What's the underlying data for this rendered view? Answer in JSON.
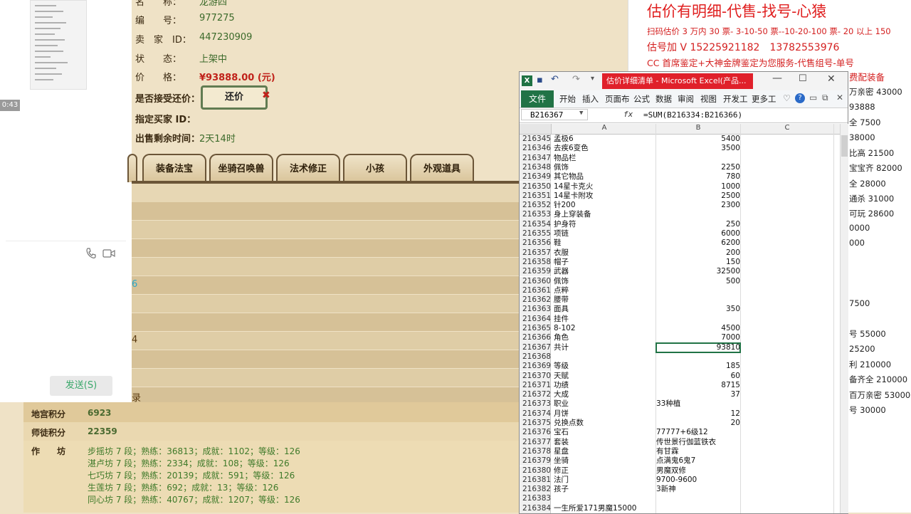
{
  "chat": {
    "time_badge": "0:43",
    "send_button": "发送(S)"
  },
  "listing": {
    "name_label": "名　　称：",
    "name_value": "龙游四",
    "id_label": "编　　号：",
    "id_value": "977275",
    "seller_label": "卖　家　ID：",
    "seller_value": "447230909",
    "status_label": "状　　态：",
    "status_value": "上架中",
    "price_label": "价　　格：",
    "price_value": "¥93888.00 (元)",
    "offer_label": "是否接受还价：",
    "offer_button": "还价",
    "buyer_label": "指定买家 ID：",
    "remain_label": "出售剩余时间：",
    "remain_value": "2天14时",
    "tabs": [
      "装备法宝",
      "坐骑召唤兽",
      "法术修正",
      "小孩",
      "外观道具"
    ],
    "partial_values": [
      "6",
      "4",
      "录"
    ]
  },
  "stats": {
    "items": [
      {
        "label": "地宫积分",
        "value": "6923"
      },
      {
        "label": "师徒积分",
        "value": "22359"
      }
    ],
    "workshop_label": "作　　坊",
    "workshops": [
      "步摇坊 7 段；熟练：36813；成就：1102；等级：126",
      "湛卢坊 7 段；熟练：2334；成就：108；等级：126",
      "七巧坊 7 段；熟练：20139；成就：591；等级：126",
      "生莲坊 7 段；熟练：692；成就：13；等级：126",
      "同心坊 7 段；熟练：40767；成就：1207；等级：126"
    ]
  },
  "doc": {
    "title": "估价有明细-代售-找号-心猿",
    "lines": [
      "扫码估价 3 万内 30 票- 3-10-50 票--10-20-100 票- 20 以上 150",
      "估号加 V 15225921182　13782553976",
      "CC 首席鉴定+大神金牌鉴定为您服务-代售组号-单号",
      "费配装备"
    ],
    "right_values": [
      "万亲密 43000",
      "93888",
      "全 7500",
      "38000",
      "比高 21500",
      "宝宝齐 82000",
      "全 28000",
      "通杀 31000",
      "可玩 28600",
      "0000",
      "000",
      "7500",
      "号 55000",
      "25200",
      "利 210000",
      "备齐全 210000",
      "百万亲密 53000",
      "号 30000"
    ]
  },
  "excel": {
    "window_title": "估价详细清单 - Microsoft Excel(产品...",
    "ribbon_file": "文件",
    "ribbon_tabs": [
      "开始",
      "插入",
      "页面布",
      "公式",
      "数据",
      "审阅",
      "视图",
      "开发工",
      "更多工"
    ],
    "name_box": "B216367",
    "fx": "fx",
    "formula": "=SUM(B216334:B216366)",
    "col_headers": [
      "A",
      "B",
      "C"
    ],
    "rows": [
      {
        "n": "216345",
        "a": "孟极6",
        "b": "5400",
        "num": true
      },
      {
        "n": "216346",
        "a": "去疾6变色",
        "b": "3500",
        "num": true
      },
      {
        "n": "216347",
        "a": "物品栏",
        "b": "",
        "num": true
      },
      {
        "n": "216348",
        "a": "佩饰",
        "b": "2250",
        "num": true
      },
      {
        "n": "216349",
        "a": "其它物品",
        "b": "780",
        "num": true
      },
      {
        "n": "216350",
        "a": "14星卡克火",
        "b": "1000",
        "num": true
      },
      {
        "n": "216351",
        "a": "14星卡附攻",
        "b": "2500",
        "num": true
      },
      {
        "n": "216352",
        "a": "针200",
        "b": "2300",
        "num": true
      },
      {
        "n": "216353",
        "a": "身上穿装备",
        "b": "",
        "num": true
      },
      {
        "n": "216354",
        "a": "护身符",
        "b": "250",
        "num": true
      },
      {
        "n": "216355",
        "a": "项链",
        "b": "6000",
        "num": true
      },
      {
        "n": "216356",
        "a": "鞋",
        "b": "6200",
        "num": true
      },
      {
        "n": "216357",
        "a": "衣服",
        "b": "200",
        "num": true
      },
      {
        "n": "216358",
        "a": "帽子",
        "b": "150",
        "num": true
      },
      {
        "n": "216359",
        "a": "武器",
        "b": "32500",
        "num": true
      },
      {
        "n": "216360",
        "a": "佩饰",
        "b": "500",
        "num": true
      },
      {
        "n": "216361",
        "a": "点粹",
        "b": "",
        "num": true
      },
      {
        "n": "216362",
        "a": "腰带",
        "b": "",
        "num": true
      },
      {
        "n": "216363",
        "a": "面具",
        "b": "350",
        "num": true
      },
      {
        "n": "216364",
        "a": "挂件",
        "b": "",
        "num": true
      },
      {
        "n": "216365",
        "a": "8-102",
        "b": "4500",
        "num": true
      },
      {
        "n": "216366",
        "a": "角色",
        "b": "7000",
        "num": true
      },
      {
        "n": "216367",
        "a": "共计",
        "b": "93810",
        "num": true
      },
      {
        "n": "216368",
        "a": "",
        "b": "",
        "num": true
      },
      {
        "n": "216369",
        "a": "等级",
        "b": "185",
        "num": true
      },
      {
        "n": "216370",
        "a": "天赋",
        "b": "60",
        "num": true
      },
      {
        "n": "216371",
        "a": "功绩",
        "b": "8715",
        "num": true
      },
      {
        "n": "216372",
        "a": "大成",
        "b": "37",
        "num": true
      },
      {
        "n": "216373",
        "a": "职业",
        "b": "33种植",
        "num": false
      },
      {
        "n": "216374",
        "a": "月饼",
        "b": "12",
        "num": true
      },
      {
        "n": "216375",
        "a": "兑换点数",
        "b": "20",
        "num": true
      },
      {
        "n": "216376",
        "a": "宝石",
        "b": "77777+6级12",
        "num": false
      },
      {
        "n": "216377",
        "a": "套装",
        "b": "传世景行伽蓝铁衣",
        "num": false
      },
      {
        "n": "216378",
        "a": "星盘",
        "b": "有甘霖",
        "num": false
      },
      {
        "n": "216379",
        "a": "坐骑",
        "b": "点满鬼6鬼7",
        "num": false
      },
      {
        "n": "216380",
        "a": "修正",
        "b": "男魔双修",
        "num": false
      },
      {
        "n": "216381",
        "a": "法门",
        "b": "9700-9600",
        "num": false
      },
      {
        "n": "216382",
        "a": "孩子",
        "b": "3新神",
        "num": false
      },
      {
        "n": "216383",
        "a": "",
        "b": "",
        "num": true
      },
      {
        "n": "216384",
        "a": "一生所爱171男魔15000",
        "b": "",
        "num": true
      }
    ]
  }
}
